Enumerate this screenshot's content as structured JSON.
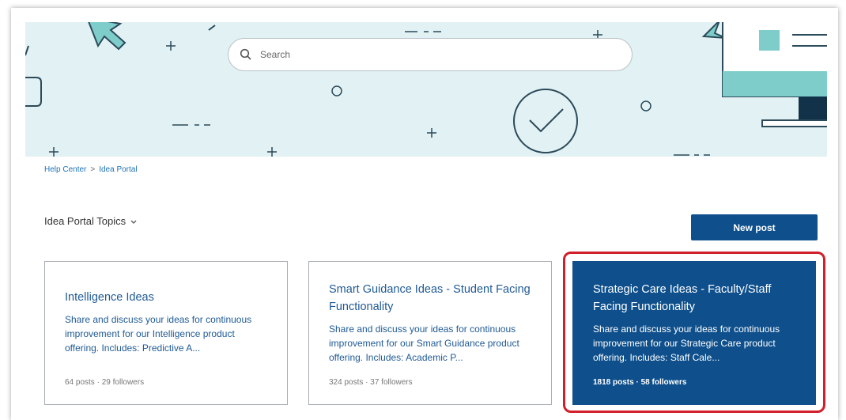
{
  "search": {
    "placeholder": "Search"
  },
  "breadcrumb": {
    "items": [
      "Help Center",
      "Idea Portal"
    ],
    "separator": ">"
  },
  "topics": {
    "label": "Idea Portal Topics"
  },
  "actions": {
    "new_post": "New post"
  },
  "cards": [
    {
      "title": "Intelligence Ideas",
      "description": "Share and discuss your ideas for continuous improvement for our Intelligence product offering. Includes: Predictive A...",
      "posts": "64 posts",
      "followers": "29 followers"
    },
    {
      "title": "Smart Guidance Ideas - Student Facing Functionality",
      "description": "Share and discuss your ideas for continuous improvement for our Smart Guidance product offering. Includes: Academic P...",
      "posts": "324 posts",
      "followers": "37 followers"
    },
    {
      "title": "Strategic Care Ideas - Faculty/Staff Facing Functionality",
      "description": "Share and discuss your ideas for continuous improvement for our Strategic Care product offering. Includes: Staff Cale...",
      "posts": "1818 posts",
      "followers": "58 followers",
      "highlighted": true
    }
  ],
  "meta_separator": "·",
  "colors": {
    "hero_bg": "#e2f1f3",
    "accent_teal": "#7ecdca",
    "brand_blue": "#0e4f8c",
    "link_blue": "#1f73b7",
    "highlight_red": "#d11f2b"
  }
}
